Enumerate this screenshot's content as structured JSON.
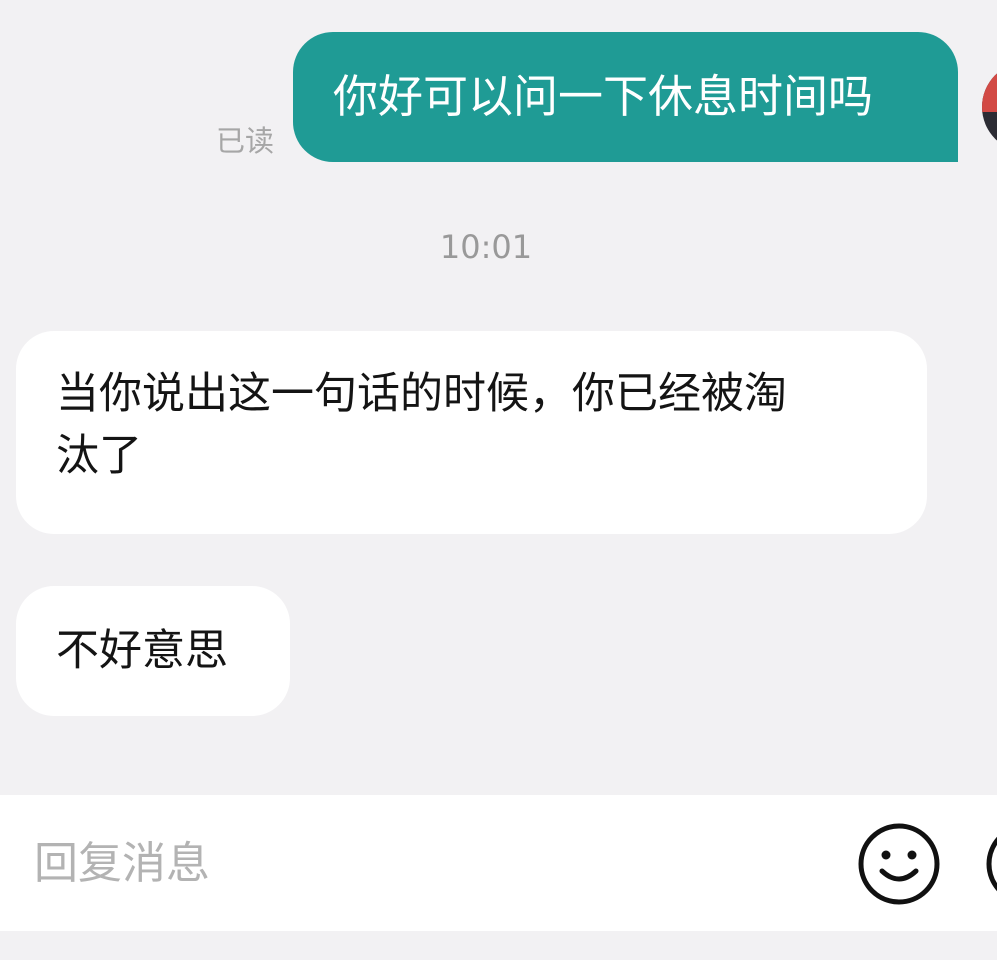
{
  "conversation": {
    "outgoing": {
      "text": "你好可以问一下休息时间吗",
      "status": "已读"
    },
    "timestamp": "10:01",
    "incoming": [
      {
        "lines": [
          "当你说出这一句话的时候，你已经被淘",
          "汰了"
        ]
      },
      {
        "lines": [
          "不好意思"
        ]
      }
    ]
  },
  "input_bar": {
    "placeholder": "回复消息",
    "emoji_icon": "smiley-face-icon",
    "more_icon": "circle-more-icon"
  },
  "colors": {
    "background": "#f2f1f3",
    "outgoing_bubble": "#1f9b95",
    "incoming_bubble": "#ffffff",
    "muted_text": "#a6a6a6"
  }
}
